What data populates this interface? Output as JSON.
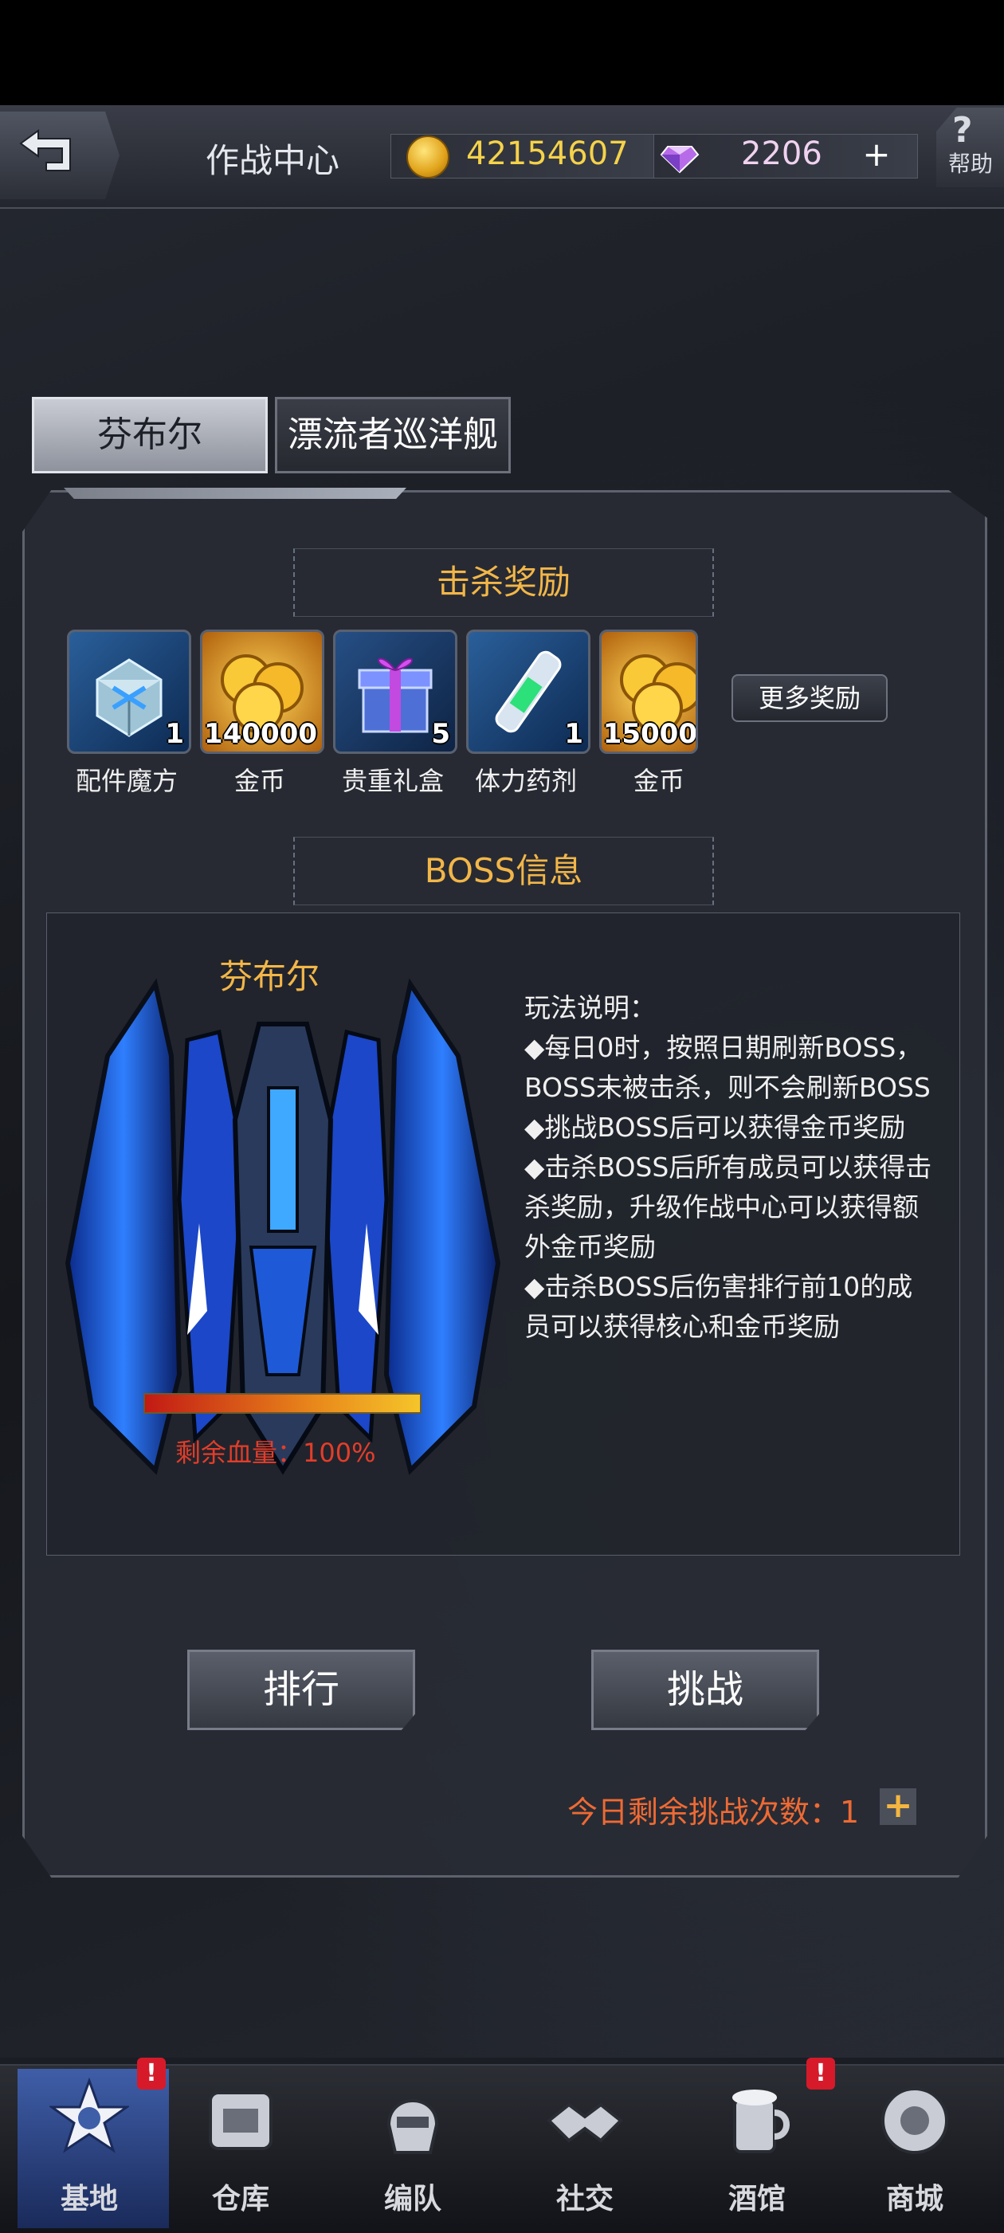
{
  "header": {
    "title": "作战中心",
    "gold": "42154607",
    "gems": "2206",
    "add_label": "+",
    "help_label": "帮助",
    "help_mark": "?"
  },
  "tabs": [
    {
      "label": "芬布尔"
    },
    {
      "label": "漂流者巡洋舰"
    }
  ],
  "rewards": {
    "title": "击杀奖励",
    "items": [
      {
        "label": "配件魔方",
        "count": "1",
        "icon": "parts-cube-icon"
      },
      {
        "label": "金币",
        "count": "140000",
        "icon": "gold-coins-icon"
      },
      {
        "label": "贵重礼盒",
        "count": "5",
        "icon": "gift-box-icon"
      },
      {
        "label": "体力药剂",
        "count": "1",
        "icon": "stamina-potion-icon"
      },
      {
        "label": "金币",
        "count": "15000",
        "icon": "gold-coins-icon"
      }
    ],
    "more_label": "更多奖励"
  },
  "boss": {
    "section_title": "BOSS信息",
    "name": "芬布尔",
    "hp_text": "剩余血量：100%",
    "hp_fraction": 1.0,
    "rules_title": "玩法说明：",
    "rules": [
      "◆每日0时，按照日期刷新BOSS，BOSS未被击杀，则不会刷新BOSS",
      "◆挑战BOSS后可以获得金币奖励",
      "◆击杀BOSS后所有成员可以获得击杀奖励，升级作战中心可以获得额外金币奖励",
      "◆击杀BOSS后伤害排行前10的成员可以获得核心和金币奖励"
    ]
  },
  "actions": {
    "rank_label": "排行",
    "challenge_label": "挑战",
    "remaining_text": "今日剩余挑战次数：1",
    "add_label": "+"
  },
  "nav": {
    "items": [
      {
        "label": "基地",
        "icon": "base-emblem-icon"
      },
      {
        "label": "仓库",
        "icon": "warehouse-icon"
      },
      {
        "label": "编队",
        "icon": "formation-helmet-icon"
      },
      {
        "label": "社交",
        "icon": "handshake-icon"
      },
      {
        "label": "酒馆",
        "icon": "tavern-icon"
      },
      {
        "label": "商城",
        "icon": "shop-icon"
      }
    ],
    "badge": "!"
  },
  "colors": {
    "accent_gold": "#f2b648",
    "hp_text": "#e33d2a",
    "remaining_text": "#ef6a33"
  }
}
